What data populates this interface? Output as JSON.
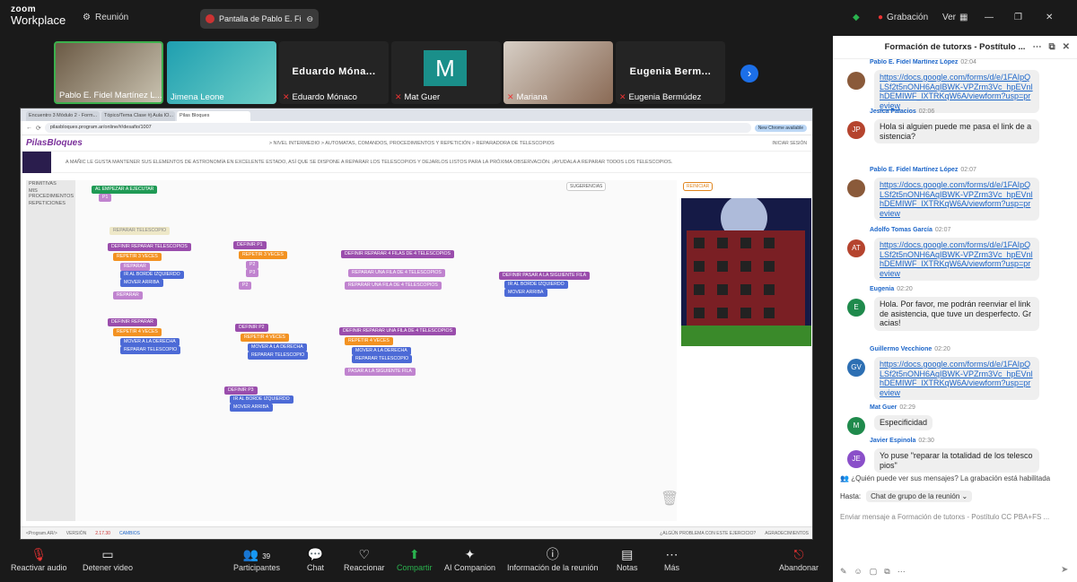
{
  "topbar": {
    "brand_top": "zoom",
    "brand_bottom": "Workplace",
    "meeting": "Reunión",
    "share_title": "Pantalla de Pablo E. Fi...",
    "recording": "Grabación",
    "view": "Ver"
  },
  "participants": [
    {
      "name": "Pablo E. Fidel Martínez L...",
      "video": true,
      "muted": false
    },
    {
      "name": "Jimena Leone",
      "video": true,
      "muted": false
    },
    {
      "name": "Eduardo Mónaco",
      "display": "Eduardo Móna...",
      "video": false,
      "muted": true
    },
    {
      "name": "Mat Guer",
      "display": "M",
      "video": false,
      "muted": true
    },
    {
      "name": "Mariana",
      "video": true,
      "muted": true
    },
    {
      "name": "Eugenia Bermúdez",
      "display": "Eugenia Berm...",
      "video": false,
      "muted": true
    }
  ],
  "screen": {
    "tabs": [
      "Encuentro 3 Módulo 2 - Form...",
      "Tópico/Tema Clase #j Aula IO...",
      "Pilas Bloques"
    ],
    "url": "pilasbloques.program.ar/online/#/desafio/1007",
    "url_btn": "New Chrome available",
    "logo": "PilasBloques",
    "crumbs": "> NIVEL INTERMEDIO > AUTOMATAS, COMANDOS, PROCEDIMIENTOS Y REPETICIÓN > REPARADORA DE TELESCOPIOS",
    "login": "INICIAR SESIÓN",
    "description": "A MAÑIC LE GUSTA MANTENER SUS ELEMENTOS DE ASTRONOMÍA EN EXCELENTE ESTADO, ASÍ QUE SE DISPONE A REPARAR LOS TELESCOPIOS Y DEJARLOS LISTOS PARA LA PRÓXIMA OBSERVACIÓN. ¡AYUDALA A REPARAR TODOS LOS TELESCOPIOS.",
    "side": [
      "PRIMITIVAS",
      "MIS PROCEDIMIENTOS",
      "REPETICIONES"
    ],
    "toolbar": {
      "suggestions": "SUGERENCIAS",
      "restart": "REINICIAR"
    },
    "blocks": {
      "start": "AL EMPEZAR A EJECUTAR",
      "p1": "P1",
      "ghost": "REPARAR TELESCOPIO",
      "def": "DEFINIR",
      "rep_tel": "REPARAR TELESCOPIOS",
      "repetir": "REPETIR",
      "veces": "VECES",
      "n3": "3",
      "n4": "4",
      "reparar": "REPARAR",
      "ir_izq": "IR AL BORDE IZQUIERDO",
      "mover_arriba": "MOVER ARRIBA",
      "mover_derecha": "MOVER A LA DERECHA",
      "reparar_tel": "REPARAR TELESCOPIO",
      "p2": "P2",
      "p3": "P3",
      "rep_4filas": "REPARAR 4 FILAS DE 4 TELESCOPIOS",
      "rep_fila": "REPARAR UNA FILA DE 4 TELESCOPIOS",
      "pasar": "PASAR A LA SIGUIENTE FILA"
    },
    "footer": {
      "brand": "<Program.AR/>",
      "version_label": "VERSIÓN",
      "version": "2.17.30",
      "changes": "CAMBIOS",
      "problem": "¿ALGÚN PROBLEMA CON ESTE EJERCICIO?",
      "thanks": "AGRADECIMIENTOS"
    }
  },
  "chat": {
    "title": "Formación de tutorxs - Postítulo ...",
    "messages": [
      {
        "name": "Pablo E. Fidel Martínez López",
        "time": "02:04",
        "text": "https://docs.google.com/forms/d/e/1FAIpQLSf2t5nONH6AqIBWK-VPZrm3Vc_hpEVnlhDEMIWF_lXTRKqW6A/viewform?usp=preview",
        "link": true,
        "initials": "",
        "color": "#8a5a3a"
      },
      {
        "name": "Jesica Palacios",
        "time": "02:06",
        "text": "Hola si alguien puede me pasa el link de asistencia?",
        "link": false,
        "initials": "JP",
        "color": "#b5442e"
      },
      {
        "name": "Pablo E. Fidel Martínez López",
        "time": "02:07",
        "text": "https://docs.google.com/forms/d/e/1FAIpQLSf2t5nONH6AqIBWK-VPZrm3Vc_hpEVnlhDEMIWF_lXTRKqW6A/viewform?usp=preview",
        "link": true,
        "initials": "",
        "color": "#8a5a3a"
      },
      {
        "name": "Adolfo Tomas García",
        "time": "02:07",
        "text": "https://docs.google.com/forms/d/e/1FAIpQLSf2t5nONH6AqIBWK-VPZrm3Vc_hpEVnlhDEMIWF_lXTRKqW6A/viewform?usp=preview",
        "link": true,
        "initials": "AT",
        "color": "#b5442e"
      },
      {
        "name": "Eugenia",
        "time": "02:20",
        "text": "Hola. Por favor, me podrán reenviar el link de asistencia, que tuve un desperfecto. Gracias!",
        "link": false,
        "initials": "E",
        "color": "#1f8a4c"
      },
      {
        "name": "Guillermo Vecchione",
        "time": "02:20",
        "text": "https://docs.google.com/forms/d/e/1FAIpQLSf2t5nONH6AqIBWK-VPZrm3Vc_hpEVnlhDEMIWF_lXTRKqW6A/viewform?usp=preview",
        "link": true,
        "initials": "GV",
        "color": "#2d6fb3"
      },
      {
        "name": "Mat Guer",
        "time": "02:29",
        "text": "Especificidad",
        "link": false,
        "initials": "M",
        "color": "#1f8a4c"
      },
      {
        "name": "Javier Espinola",
        "time": "02:30",
        "text": "Yo puse \"reparar la totalidad de los telescopios\"",
        "link": false,
        "initials": "JE",
        "color": "#8a4fc9"
      }
    ],
    "visibility_note": "¿Quién puede ver sus mensajes? La grabación está habilitada",
    "to_label": "Hasta:",
    "to_value": "Chat de grupo de la reunión",
    "input_placeholder": "Enviar mensaje a Formación de tutorxs - Postítulo CC PBA+FS ..."
  },
  "toolbar": [
    {
      "label": "Reactivar audio",
      "icon": "mic-off-icon"
    },
    {
      "label": "Detener video",
      "icon": "video-icon"
    },
    {
      "label": "Participantes",
      "icon": "participants-icon",
      "count": "39"
    },
    {
      "label": "Chat",
      "icon": "chat-icon"
    },
    {
      "label": "Reaccionar",
      "icon": "heart-icon"
    },
    {
      "label": "Compartir",
      "icon": "share-icon"
    },
    {
      "label": "AI Companion",
      "icon": "sparkle-icon"
    },
    {
      "label": "Información de la reunión",
      "icon": "info-icon"
    },
    {
      "label": "Notas",
      "icon": "notes-icon"
    },
    {
      "label": "Más",
      "icon": "more-icon"
    },
    {
      "label": "Abandonar",
      "icon": "leave-icon"
    }
  ]
}
